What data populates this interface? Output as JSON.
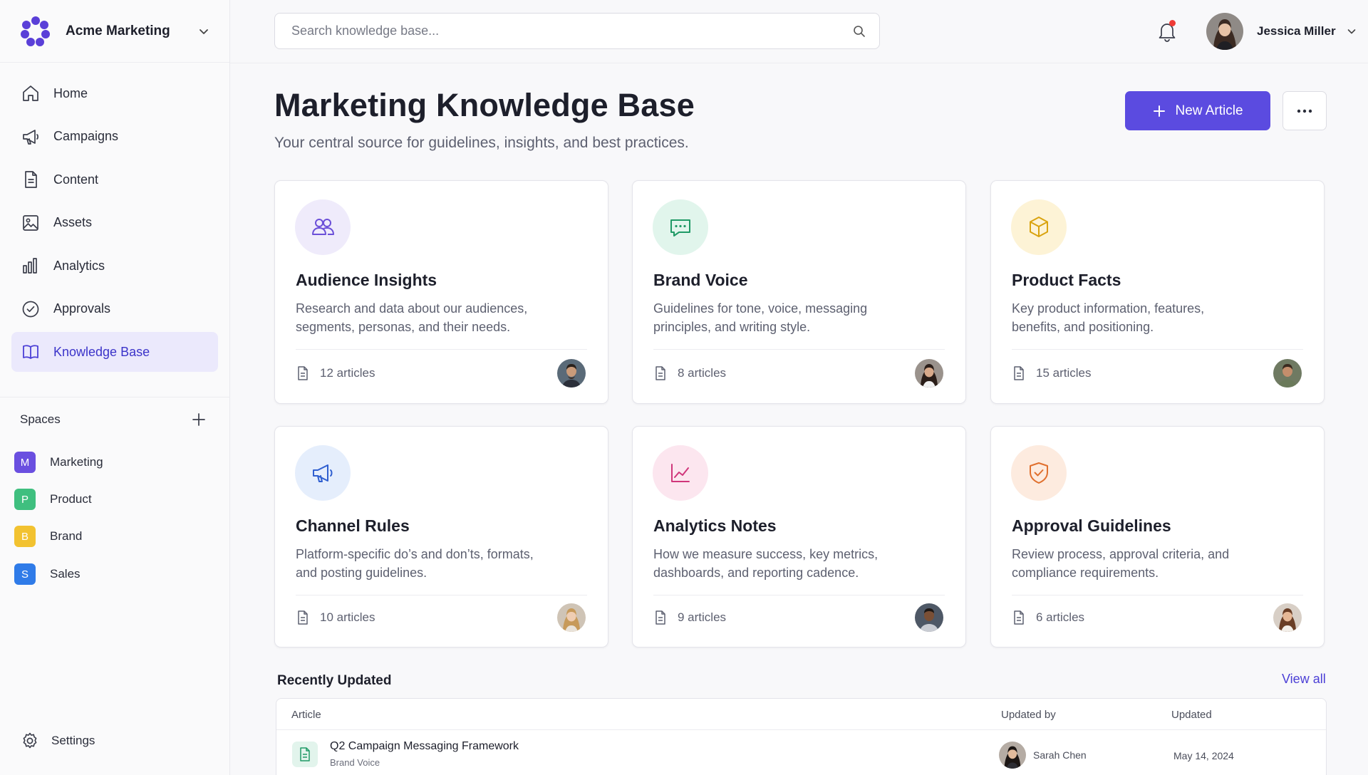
{
  "workspace": {
    "name": "Acme Marketing"
  },
  "search": {
    "placeholder": "Search knowledge base..."
  },
  "user": {
    "name": "Jessica Miller"
  },
  "nav": {
    "items": [
      {
        "label": "Home",
        "icon": "home-icon"
      },
      {
        "label": "Campaigns",
        "icon": "megaphone-icon"
      },
      {
        "label": "Content",
        "icon": "document-icon"
      },
      {
        "label": "Assets",
        "icon": "image-icon"
      },
      {
        "label": "Analytics",
        "icon": "bar-chart-icon"
      },
      {
        "label": "Approvals",
        "icon": "check-circle-icon"
      },
      {
        "label": "Knowledge Base",
        "icon": "book-icon",
        "active": true
      }
    ]
  },
  "spaces": {
    "title": "Spaces",
    "items": [
      {
        "letter": "M",
        "label": "Marketing",
        "color": "#6a4fe0"
      },
      {
        "letter": "P",
        "label": "Product",
        "color": "#3fbf7f"
      },
      {
        "letter": "B",
        "label": "Brand",
        "color": "#f2c230"
      },
      {
        "letter": "S",
        "label": "Sales",
        "color": "#2f7be8"
      }
    ]
  },
  "settings": {
    "label": "Settings"
  },
  "page": {
    "title": "Marketing Knowledge Base",
    "subtitle": "Your central source for guidelines, insights, and best practices.",
    "new_button": "New Article"
  },
  "cards": [
    {
      "title": "Audience Insights",
      "desc": "Research and data about our audiences, segments, personas, and their needs.",
      "count": "12 articles",
      "icon": "users-icon",
      "accent": "#6b4fd8",
      "tint": "#efebfb"
    },
    {
      "title": "Brand Voice",
      "desc": "Guidelines for tone, voice, messaging principles, and writing style.",
      "count": "8 articles",
      "icon": "chat-bubble-icon",
      "accent": "#1f9a66",
      "tint": "#e1f5ec"
    },
    {
      "title": "Product Facts",
      "desc": "Key product information, features, benefits, and positioning.",
      "count": "15 articles",
      "icon": "box-icon",
      "accent": "#d9a30f",
      "tint": "#fdf3d6"
    },
    {
      "title": "Channel Rules",
      "desc": "Platform-specific do’s and don’ts, formats, and posting guidelines.",
      "count": "10 articles",
      "icon": "megaphone-icon",
      "accent": "#2f5fd0",
      "tint": "#e5eefc"
    },
    {
      "title": "Analytics Notes",
      "desc": "How we measure success, key metrics, dashboards, and reporting cadence.",
      "count": "9 articles",
      "icon": "trend-chart-icon",
      "accent": "#d0367a",
      "tint": "#fce6ef"
    },
    {
      "title": "Approval Guidelines",
      "desc": "Review process, approval criteria, and compliance requirements.",
      "count": "6 articles",
      "icon": "shield-check-icon",
      "accent": "#e0702e",
      "tint": "#fdebdf"
    }
  ],
  "recent": {
    "title": "Recently Updated",
    "view_all": "View all",
    "columns": [
      "Article",
      "Updated by",
      "Updated"
    ],
    "rows": [
      {
        "title": "Q2 Campaign Messaging Framework",
        "space": "Brand Voice",
        "updated_by": "Sarah Chen",
        "date": "May 14, 2024"
      }
    ]
  }
}
